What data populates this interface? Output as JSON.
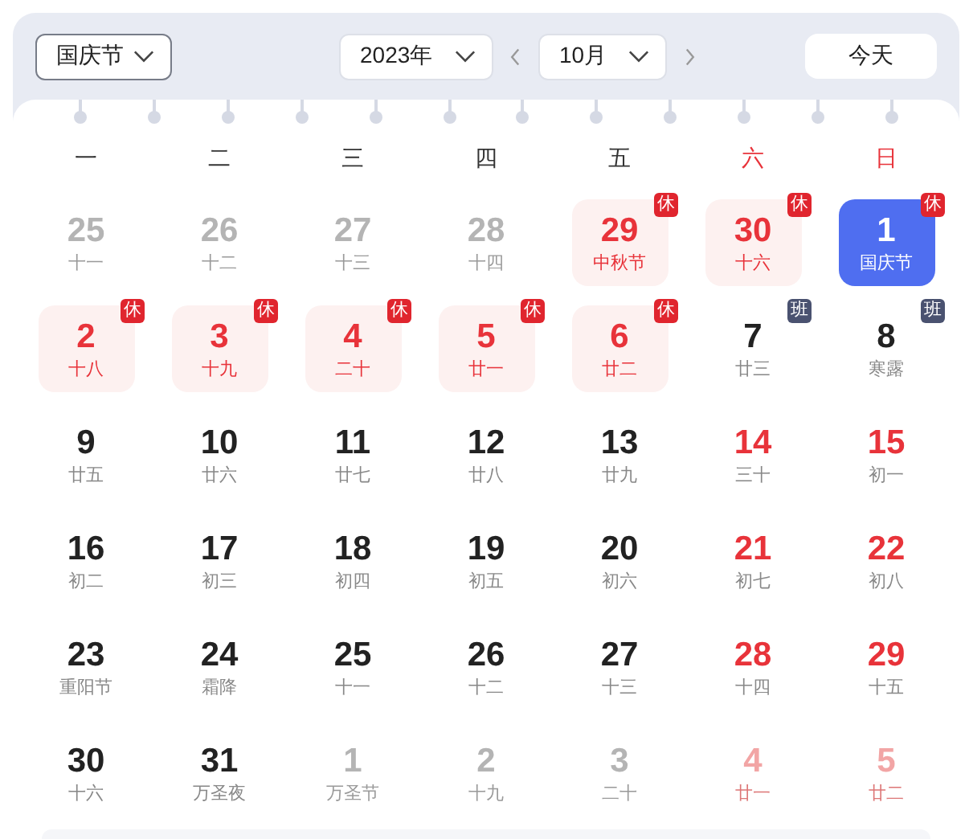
{
  "toolbar": {
    "holiday_select": "国庆节",
    "year_select": "2023年",
    "month_select": "10月",
    "today_button": "今天"
  },
  "weekdays": [
    {
      "label": "一",
      "weekend": false
    },
    {
      "label": "二",
      "weekend": false
    },
    {
      "label": "三",
      "weekend": false
    },
    {
      "label": "四",
      "weekend": false
    },
    {
      "label": "五",
      "weekend": false
    },
    {
      "label": "六",
      "weekend": true
    },
    {
      "label": "日",
      "weekend": true
    }
  ],
  "days": [
    {
      "day": "25",
      "lunar": "十一",
      "other_month": true,
      "weekend": false,
      "holiday": false,
      "selected": false
    },
    {
      "day": "26",
      "lunar": "十二",
      "other_month": true,
      "weekend": false,
      "holiday": false,
      "selected": false
    },
    {
      "day": "27",
      "lunar": "十三",
      "other_month": true,
      "weekend": false,
      "holiday": false,
      "selected": false
    },
    {
      "day": "28",
      "lunar": "十四",
      "other_month": true,
      "weekend": false,
      "holiday": false,
      "selected": false
    },
    {
      "day": "29",
      "lunar": "中秋节",
      "other_month": true,
      "weekend": false,
      "holiday": true,
      "badge": {
        "text": "休",
        "kind": "rest"
      },
      "selected": false
    },
    {
      "day": "30",
      "lunar": "十六",
      "other_month": true,
      "weekend": true,
      "holiday": true,
      "badge": {
        "text": "休",
        "kind": "rest"
      },
      "selected": false
    },
    {
      "day": "1",
      "lunar": "国庆节",
      "other_month": false,
      "weekend": true,
      "holiday": true,
      "badge": {
        "text": "休",
        "kind": "rest"
      },
      "selected": true
    },
    {
      "day": "2",
      "lunar": "十八",
      "other_month": false,
      "weekend": false,
      "holiday": true,
      "badge": {
        "text": "休",
        "kind": "rest"
      },
      "selected": false
    },
    {
      "day": "3",
      "lunar": "十九",
      "other_month": false,
      "weekend": false,
      "holiday": true,
      "badge": {
        "text": "休",
        "kind": "rest"
      },
      "selected": false
    },
    {
      "day": "4",
      "lunar": "二十",
      "other_month": false,
      "weekend": false,
      "holiday": true,
      "badge": {
        "text": "休",
        "kind": "rest"
      },
      "selected": false
    },
    {
      "day": "5",
      "lunar": "廿一",
      "other_month": false,
      "weekend": false,
      "holiday": true,
      "badge": {
        "text": "休",
        "kind": "rest"
      },
      "selected": false
    },
    {
      "day": "6",
      "lunar": "廿二",
      "other_month": false,
      "weekend": false,
      "holiday": true,
      "badge": {
        "text": "休",
        "kind": "rest"
      },
      "selected": false
    },
    {
      "day": "7",
      "lunar": "廿三",
      "other_month": false,
      "weekend": false,
      "holiday": false,
      "badge": {
        "text": "班",
        "kind": "work"
      },
      "selected": false
    },
    {
      "day": "8",
      "lunar": "寒露",
      "other_month": false,
      "weekend": false,
      "holiday": false,
      "badge": {
        "text": "班",
        "kind": "work"
      },
      "selected": false
    },
    {
      "day": "9",
      "lunar": "廿五",
      "other_month": false,
      "weekend": false,
      "holiday": false,
      "selected": false
    },
    {
      "day": "10",
      "lunar": "廿六",
      "other_month": false,
      "weekend": false,
      "holiday": false,
      "selected": false
    },
    {
      "day": "11",
      "lunar": "廿七",
      "other_month": false,
      "weekend": false,
      "holiday": false,
      "selected": false
    },
    {
      "day": "12",
      "lunar": "廿八",
      "other_month": false,
      "weekend": false,
      "holiday": false,
      "selected": false
    },
    {
      "day": "13",
      "lunar": "廿九",
      "other_month": false,
      "weekend": false,
      "holiday": false,
      "selected": false
    },
    {
      "day": "14",
      "lunar": "三十",
      "other_month": false,
      "weekend": true,
      "holiday": false,
      "selected": false
    },
    {
      "day": "15",
      "lunar": "初一",
      "other_month": false,
      "weekend": true,
      "holiday": false,
      "selected": false
    },
    {
      "day": "16",
      "lunar": "初二",
      "other_month": false,
      "weekend": false,
      "holiday": false,
      "selected": false
    },
    {
      "day": "17",
      "lunar": "初三",
      "other_month": false,
      "weekend": false,
      "holiday": false,
      "selected": false
    },
    {
      "day": "18",
      "lunar": "初四",
      "other_month": false,
      "weekend": false,
      "holiday": false,
      "selected": false
    },
    {
      "day": "19",
      "lunar": "初五",
      "other_month": false,
      "weekend": false,
      "holiday": false,
      "selected": false
    },
    {
      "day": "20",
      "lunar": "初六",
      "other_month": false,
      "weekend": false,
      "holiday": false,
      "selected": false
    },
    {
      "day": "21",
      "lunar": "初七",
      "other_month": false,
      "weekend": true,
      "holiday": false,
      "selected": false
    },
    {
      "day": "22",
      "lunar": "初八",
      "other_month": false,
      "weekend": true,
      "holiday": false,
      "selected": false
    },
    {
      "day": "23",
      "lunar": "重阳节",
      "other_month": false,
      "weekend": false,
      "holiday": false,
      "selected": false
    },
    {
      "day": "24",
      "lunar": "霜降",
      "other_month": false,
      "weekend": false,
      "holiday": false,
      "selected": false
    },
    {
      "day": "25",
      "lunar": "十一",
      "other_month": false,
      "weekend": false,
      "holiday": false,
      "selected": false
    },
    {
      "day": "26",
      "lunar": "十二",
      "other_month": false,
      "weekend": false,
      "holiday": false,
      "selected": false
    },
    {
      "day": "27",
      "lunar": "十三",
      "other_month": false,
      "weekend": false,
      "holiday": false,
      "selected": false
    },
    {
      "day": "28",
      "lunar": "十四",
      "other_month": false,
      "weekend": true,
      "holiday": false,
      "selected": false
    },
    {
      "day": "29",
      "lunar": "十五",
      "other_month": false,
      "weekend": true,
      "holiday": false,
      "selected": false
    },
    {
      "day": "30",
      "lunar": "十六",
      "other_month": false,
      "weekend": false,
      "holiday": false,
      "selected": false
    },
    {
      "day": "31",
      "lunar": "万圣夜",
      "other_month": false,
      "weekend": false,
      "holiday": false,
      "selected": false
    },
    {
      "day": "1",
      "lunar": "万圣节",
      "other_month": true,
      "weekend": false,
      "holiday": false,
      "selected": false
    },
    {
      "day": "2",
      "lunar": "十九",
      "other_month": true,
      "weekend": false,
      "holiday": false,
      "selected": false
    },
    {
      "day": "3",
      "lunar": "二十",
      "other_month": true,
      "weekend": false,
      "holiday": false,
      "selected": false
    },
    {
      "day": "4",
      "lunar": "廿一",
      "other_month": true,
      "weekend": true,
      "holiday": false,
      "selected": false
    },
    {
      "day": "5",
      "lunar": "廿二",
      "other_month": true,
      "weekend": true,
      "holiday": false,
      "selected": false
    }
  ]
}
